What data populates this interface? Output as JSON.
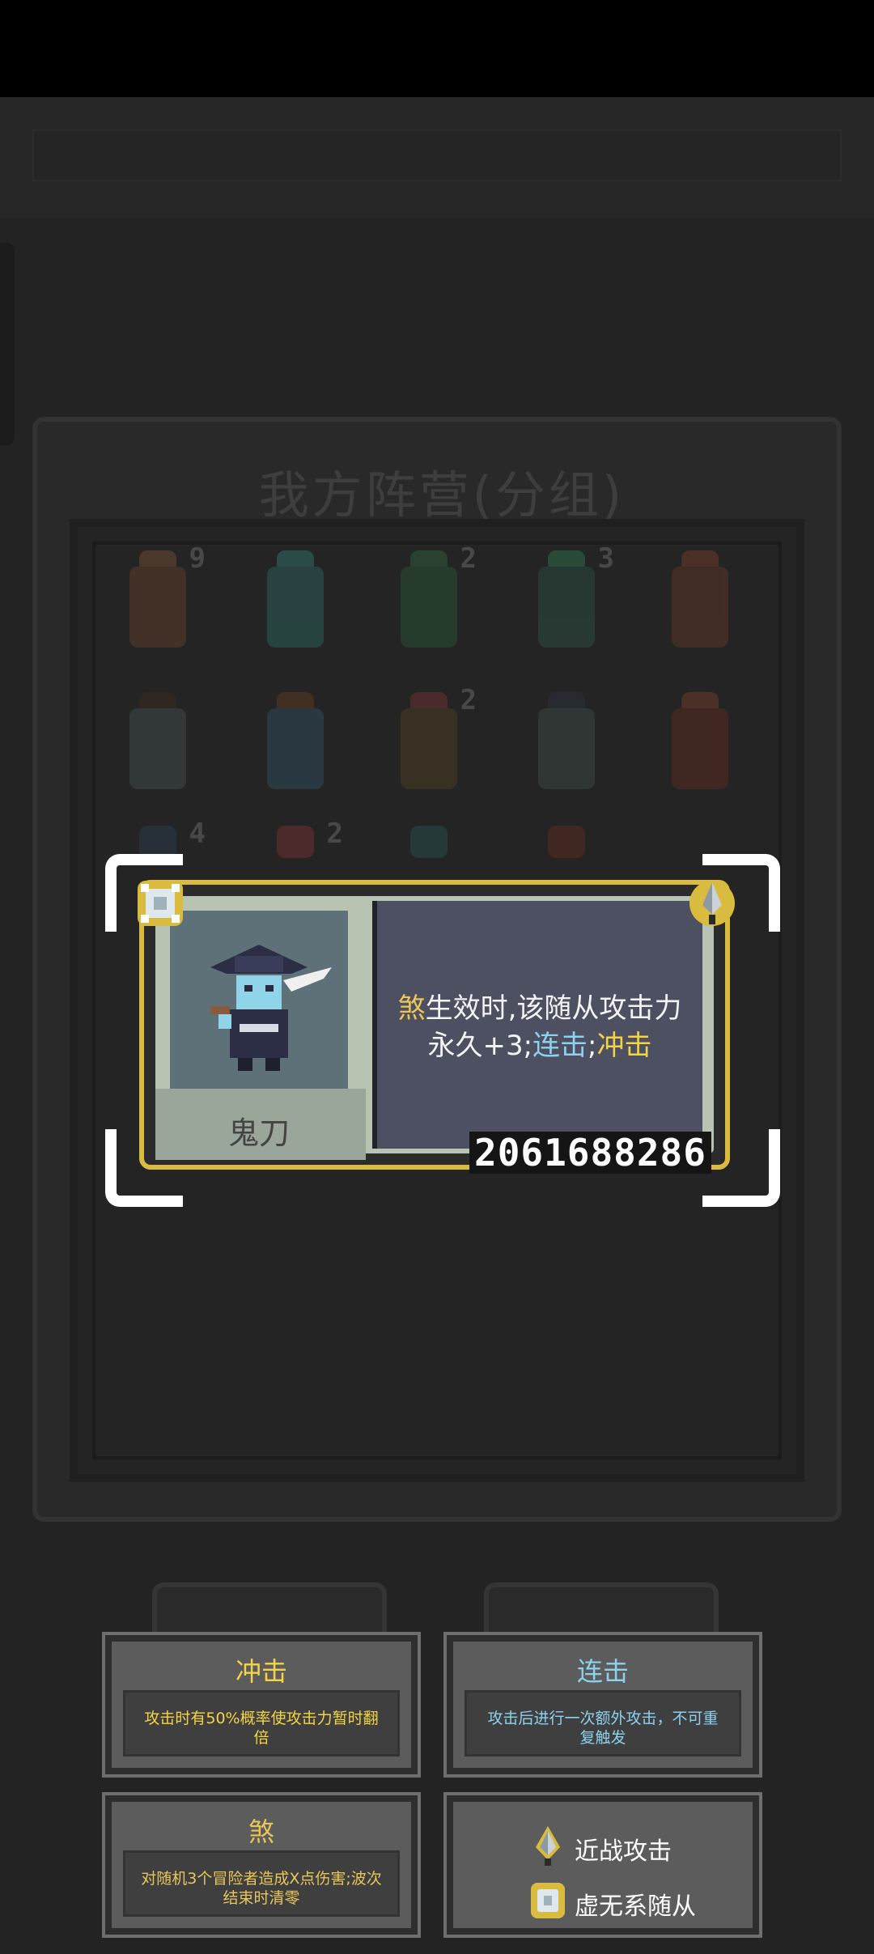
{
  "panel": {
    "title": "我方阵营(分组)"
  },
  "roster": [
    {
      "badge": "9"
    },
    {
      "badge": ""
    },
    {
      "badge": "2"
    },
    {
      "badge": "3"
    },
    {
      "badge": ""
    },
    {
      "badge": ""
    },
    {
      "badge": ""
    },
    {
      "badge": "2"
    },
    {
      "badge": ""
    },
    {
      "badge": ""
    },
    {
      "badge": "4"
    },
    {
      "badge": "2"
    },
    {
      "badge": ""
    },
    {
      "badge": ""
    }
  ],
  "card": {
    "name": "鬼刀",
    "desc_kw_sha": "煞",
    "desc_part1": "生效时,该随从攻击力永久+3;",
    "desc_kw_combo": "连击",
    "desc_sep": ";",
    "desc_kw_charge": "冲击",
    "id": "2061688286"
  },
  "keywords": [
    {
      "title": "冲击",
      "desc": "攻击时有50%概率使攻击力暂时翻倍",
      "color": "#f4d445"
    },
    {
      "title": "连击",
      "desc": "攻击后进行一次额外攻击，不可重复触发",
      "color": "#8ed1ee"
    },
    {
      "title": "煞",
      "desc": "对随机3个冒险者造成X点伤害;波次结束时清零",
      "color": "#e8c65a"
    }
  ],
  "legend": [
    {
      "label": "近战攻击",
      "icon": "melee-attack-icon"
    },
    {
      "label": "虚无系随从",
      "icon": "void-minion-icon"
    }
  ],
  "colors": {
    "card_border": "#d9bc3f",
    "desc_bg": "#4d5061",
    "accent_yellow": "#f4d445",
    "accent_blue": "#8ed1ee"
  }
}
